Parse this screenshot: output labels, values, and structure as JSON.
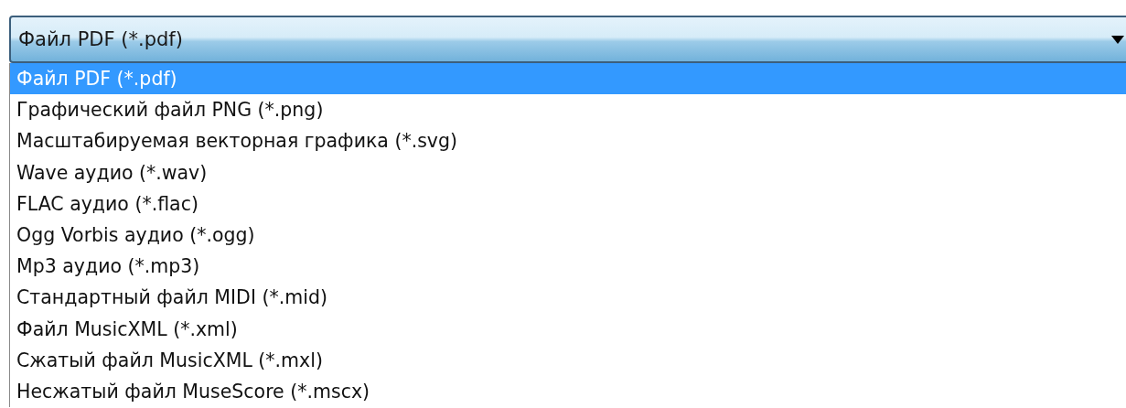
{
  "combo": {
    "value": "Файл PDF (*.pdf)",
    "expanded": true
  },
  "options": [
    {
      "label": "Файл PDF (*.pdf)",
      "selected": true
    },
    {
      "label": "Графический файл PNG (*.png)",
      "selected": false
    },
    {
      "label": "Масштабируемая векторная графика (*.svg)",
      "selected": false
    },
    {
      "label": "Wave аудио (*.wav)",
      "selected": false
    },
    {
      "label": "FLAC аудио (*.flac)",
      "selected": false
    },
    {
      "label": "Ogg Vorbis аудио (*.ogg)",
      "selected": false
    },
    {
      "label": "Mp3 аудио (*.mp3)",
      "selected": false
    },
    {
      "label": "Стандартный файл MIDI (*.mid)",
      "selected": false
    },
    {
      "label": "Файл MusicXML (*.xml)",
      "selected": false
    },
    {
      "label": "Сжатый файл MusicXML (*.mxl)",
      "selected": false
    },
    {
      "label": "Несжатый файл MuseScore (*.mscx)",
      "selected": false
    }
  ]
}
